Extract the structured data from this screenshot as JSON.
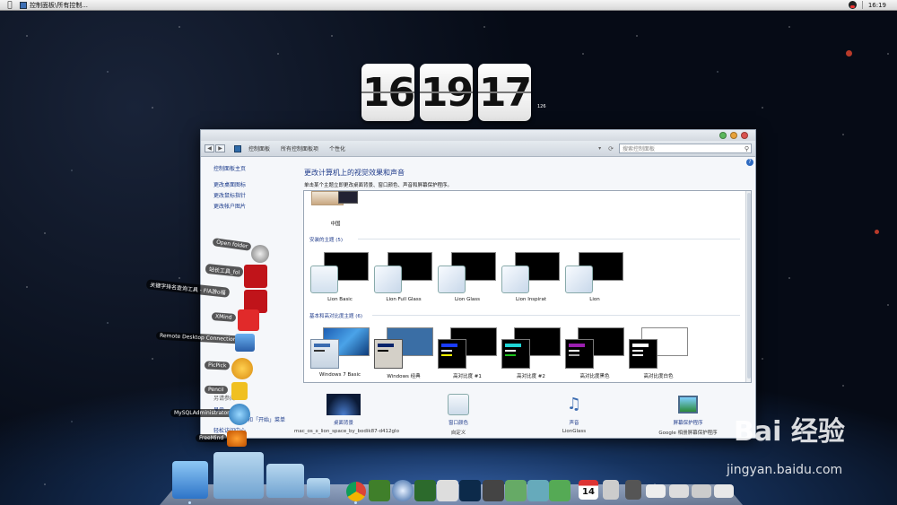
{
  "menubar": {
    "app_title": "控制面板\\所有控制...",
    "time": "16:19"
  },
  "clock": {
    "hour": "16",
    "minute": "19",
    "second": "17",
    "small": "126"
  },
  "window": {
    "breadcrumbs": [
      "控制面板",
      "所有控制面板项",
      "个性化"
    ],
    "search_placeholder": "搜索控制面板",
    "left_links": {
      "home": "控制面板主页",
      "desktop_icons": "更改桌面图标",
      "mouse_pointer": "更改鼠标指针",
      "account_picture": "更改帐户图片",
      "see_also": "另请参阅",
      "display": "显示",
      "taskbar": "任务栏和「开始」菜单",
      "ease": "轻松访问中心"
    },
    "heading": "更改计算机上的视觉效果和声音",
    "description": "单击某个主题立即更改桌面背景、窗口颜色、声音和屏幕保护程序。",
    "china_theme_label": "中国",
    "installed_group": "安装的主题 (5)",
    "installed": [
      {
        "label": "Lion Basic"
      },
      {
        "label": "Lion Full Glass"
      },
      {
        "label": "Lion Glass"
      },
      {
        "label": "Lion Inspirat"
      },
      {
        "label": "Lion"
      }
    ],
    "basic_group": "基本和高对比度主题 (6)",
    "basic": [
      {
        "label": "Windows 7 Basic"
      },
      {
        "label": "Windows 经典"
      },
      {
        "label": "高对比度 #1"
      },
      {
        "label": "高对比度 #2"
      },
      {
        "label": "高对比度黑色"
      },
      {
        "label": "高对比度白色"
      }
    ],
    "bottom": {
      "bg_title": "桌面背景",
      "bg_sub": "mac_os_x_lion_space_by_bodik87-d412glo",
      "color_title": "窗口颜色",
      "color_sub": "自定义",
      "sound_title": "声音",
      "sound_sub": "LionGlass",
      "saver_title": "屏幕保护程序",
      "saver_sub": "Google 相册屏幕保护程序"
    }
  },
  "stack": {
    "items": [
      "Open folder",
      "站长工具_fol",
      "关键字排名查询工具 - FlA游o福",
      "XMind",
      "Remote Desktop Connection",
      "PicPick",
      "Pencil",
      "MySQLAdministrator",
      "FreeMind"
    ]
  },
  "dock": {
    "calendar_day": "14"
  },
  "watermark": {
    "brand": "Bai 经验",
    "url": "jingyan.baidu.com"
  },
  "colors": {
    "link": "#1a3a8a",
    "heading": "#1e3a8a",
    "window_bg": "#f5f7fa"
  }
}
